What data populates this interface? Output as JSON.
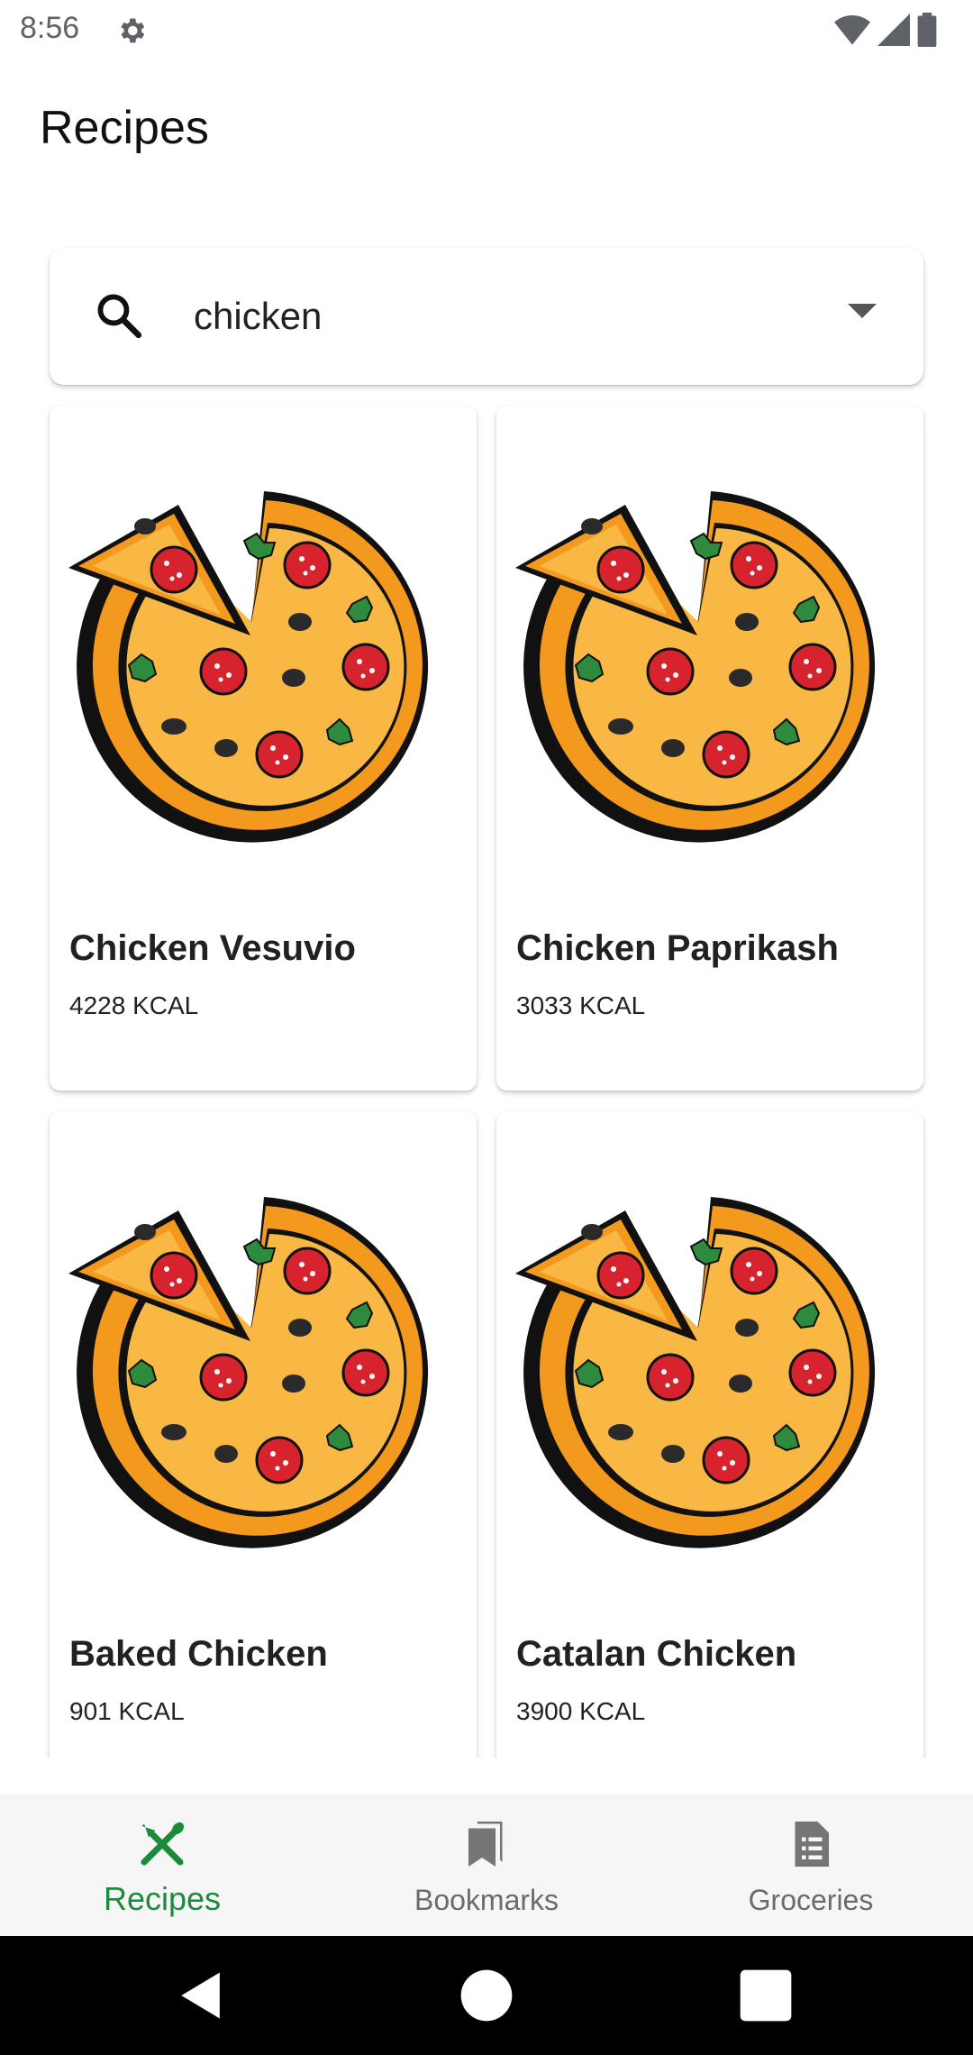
{
  "status_bar": {
    "time": "8:56"
  },
  "header": {
    "title": "Recipes"
  },
  "search": {
    "value": "chicken",
    "placeholder": ""
  },
  "recipes": [
    {
      "name": "Chicken Vesuvio",
      "kcal": "4228 KCAL"
    },
    {
      "name": "Chicken Paprikash",
      "kcal": "3033 KCAL"
    },
    {
      "name": "Baked Chicken",
      "kcal": "901 KCAL"
    },
    {
      "name": "Catalan Chicken",
      "kcal": "3900 KCAL"
    }
  ],
  "bottom_nav": {
    "items": [
      {
        "label": "Recipes",
        "icon": "fork-knife-icon",
        "active": true
      },
      {
        "label": "Bookmarks",
        "icon": "bookmarks-icon",
        "active": false
      },
      {
        "label": "Groceries",
        "icon": "list-document-icon",
        "active": false
      }
    ]
  },
  "colors": {
    "accent": "#1b8a3a",
    "crust": "#f4a024",
    "cheese": "#f7b540",
    "pepperoni": "#d6232e",
    "basil": "#2e8b3e"
  }
}
